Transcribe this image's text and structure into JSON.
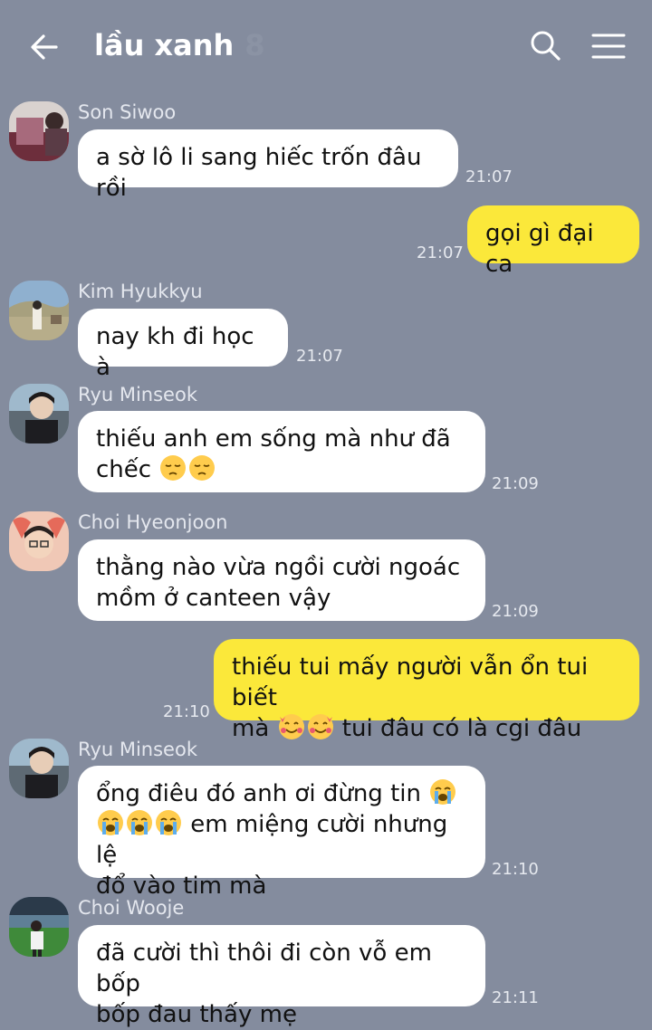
{
  "header": {
    "title": "lầu xanh",
    "member_count": "8"
  },
  "messages": [
    {
      "sender": "Son Siwoo",
      "text": "a sờ lô li sang hiếc trốn đâu rồi",
      "time": "21:07"
    },
    {
      "text": "gọi gì đại ca",
      "time": "21:07"
    },
    {
      "sender": "Kim Hyukkyu",
      "text": "nay kh đi học à",
      "time": "21:07"
    },
    {
      "sender": "Ryu Minseok",
      "line1": "thiếu anh em sống mà như đã",
      "line2_prefix": "chếc",
      "time": "21:09"
    },
    {
      "sender": "Choi Hyeonjoon",
      "line1": "thằng nào vừa ngồi cười ngoác",
      "line2": "mồm ở canteen vậy",
      "time": "21:09"
    },
    {
      "line1": "thiếu tui mấy người vẫn ổn tui biết",
      "line2_prefix": "mà",
      "line2_suffix": "tui đâu có là cgi đâu",
      "time": "21:10"
    },
    {
      "sender": "Ryu Minseok",
      "line1": "ổng điêu đó anh ơi đừng tin",
      "line2_suffix": "em miệng cười nhưng lệ",
      "line3": "đổ vào tim mà",
      "time": "21:10"
    },
    {
      "sender": "Choi Wooje",
      "line1": "đã cười thì thôi đi còn vỗ em bốp",
      "line2": "bốp đau thấy mẹ",
      "time": "21:11"
    }
  ],
  "colors": {
    "background": "#848c9e",
    "my_bubble": "#fbe83a",
    "other_bubble": "#ffffff"
  },
  "icons": [
    "back-arrow-icon",
    "search-icon",
    "menu-icon",
    "pensive-face-emoji",
    "smiling-hearts-emoji",
    "crying-face-emoji"
  ]
}
